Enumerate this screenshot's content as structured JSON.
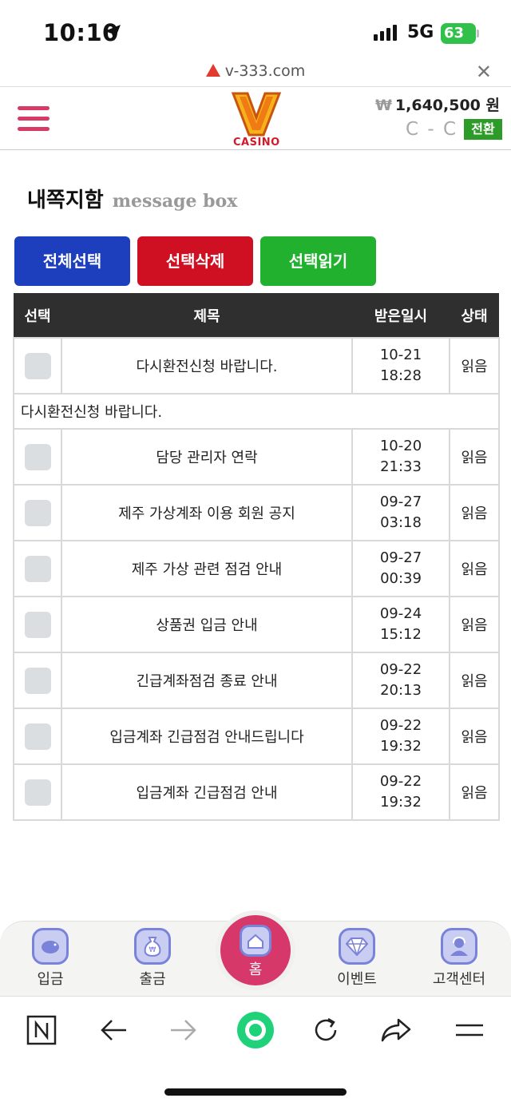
{
  "status_bar": {
    "time": "10:10",
    "network": "5G",
    "battery": "63"
  },
  "browser": {
    "url": "v-333.com"
  },
  "header": {
    "logo_text": "CASINO",
    "currency_symbol": "₩",
    "balance": "1,640,500 원",
    "refresh_label": "C - C",
    "switch_label": "전환"
  },
  "page": {
    "title": "내쪽지함",
    "subtitle": "message box"
  },
  "actions": {
    "select_all": "전체선택",
    "delete_selected": "선택삭제",
    "read_selected": "선택읽기"
  },
  "table": {
    "headers": {
      "select": "선택",
      "subject": "제목",
      "received": "받은일시",
      "status": "상태"
    },
    "expanded_message": "다시환전신청 바랍니다.",
    "rows": [
      {
        "subject": "다시환전신청 바랍니다.",
        "date": "10-21",
        "time": "18:28",
        "status": "읽음"
      },
      {
        "subject": "담당 관리자 연락",
        "date": "10-20",
        "time": "21:33",
        "status": "읽음"
      },
      {
        "subject": "제주 가상계좌 이용 회원 공지",
        "date": "09-27",
        "time": "03:18",
        "status": "읽음"
      },
      {
        "subject": "제주 가상 관련 점검 안내",
        "date": "09-27",
        "time": "00:39",
        "status": "읽음"
      },
      {
        "subject": "상품권 입금 안내",
        "date": "09-24",
        "time": "15:12",
        "status": "읽음"
      },
      {
        "subject": "긴급계좌점검 종료 안내",
        "date": "09-22",
        "time": "20:13",
        "status": "읽음"
      },
      {
        "subject": "입금계좌 긴급점검 안내드립니다",
        "date": "09-22",
        "time": "19:32",
        "status": "읽음"
      },
      {
        "subject": "입금계좌 긴급점검 안내",
        "date": "09-22",
        "time": "19:32",
        "status": "읽음"
      }
    ]
  },
  "site_nav": {
    "deposit": "입금",
    "withdraw": "출금",
    "home": "홈",
    "event": "이벤트",
    "support": "고객센터"
  },
  "colors": {
    "accent_pink": "#d6386a",
    "select_all_blue": "#1d3fbd",
    "delete_red": "#cf1023",
    "read_green": "#22b02f",
    "switch_green": "#2d9b27"
  }
}
